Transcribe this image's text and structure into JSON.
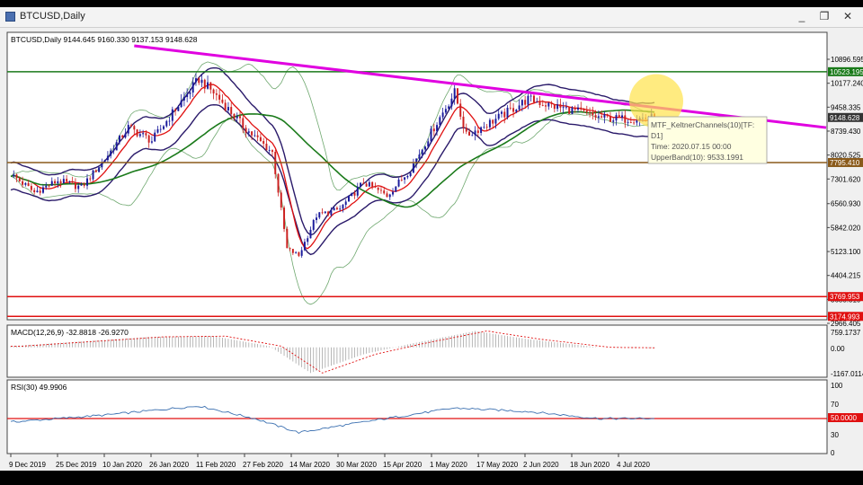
{
  "window": {
    "title": "BTCUSD,Daily",
    "minimize": "_",
    "restore": "❐",
    "close": "✕"
  },
  "colors": {
    "bull": "#1a1a9c",
    "bear": "#cc1f1f",
    "trendline": "#e000e0",
    "keltner": "#2a1a6a",
    "ma_red": "#e01010",
    "ma_green": "#1a7a1a",
    "bollinger": "#6fa86f",
    "level_green": "#1a7a1a",
    "level_brown": "#8a5a1a",
    "level_red": "#e01010",
    "macd": "#999999",
    "rsi": "#3a6fb0"
  },
  "main_chart": {
    "header": "BTCUSD,Daily  9144.645 9160.330 9137.153 9148.628",
    "price_axis": [
      "10896.595",
      "10177.240",
      "9458.335",
      "8739.430",
      "8020.525",
      "7301.620",
      "6560.930",
      "5842.020",
      "5123.100",
      "4404.215",
      "3685.310",
      "2966.405"
    ],
    "level_labels": [
      {
        "label": "10523.195",
        "value": 10523.195,
        "color": "#1a7a1a"
      },
      {
        "label": "9148.628",
        "value": 9148.628,
        "color": "#333333"
      },
      {
        "label": "7795.410",
        "value": 7795.41,
        "color": "#8a5a1a"
      },
      {
        "label": "3769.953",
        "value": 3769.953,
        "color": "#e01010"
      },
      {
        "label": "3174.993",
        "value": 3174.993,
        "color": "#e01010"
      }
    ],
    "tooltip": {
      "line1": "MTF_KeltnerChannels(10)[TF:",
      "line2": "D1]",
      "line3": "Time: 2020.07.15 00:00",
      "line4": "UpperBand(10): 9533.1991"
    }
  },
  "macd_panel": {
    "header": "MACD(12,26,9) -32.8818 -26.9270",
    "axis": [
      "759.1737",
      "0.00",
      "-1167.0114"
    ]
  },
  "rsi_panel": {
    "header": "RSI(30) 49.9906",
    "axis": [
      "100",
      "70",
      "50.0000",
      "30",
      "0"
    ]
  },
  "x_axis": [
    "9 Dec 2019",
    "25 Dec 2019",
    "10 Jan 2020",
    "26 Jan 2020",
    "11 Feb 2020",
    "27 Feb 2020",
    "14 Mar 2020",
    "30 Mar 2020",
    "15 Apr 2020",
    "1 May 2020",
    "17 May 2020",
    "2 Jun 2020",
    "18 Jun 2020",
    "4 Jul 2020"
  ],
  "chart_data": {
    "type": "candlestick",
    "title": "BTCUSD,Daily",
    "period": "Daily",
    "x_start": "2019-12-09",
    "x_end": "2020-07-15",
    "ylim": [
      2966.405,
      11300
    ],
    "close_anchors": [
      [
        "2019-12-09",
        7450
      ],
      [
        "2019-12-17",
        6900
      ],
      [
        "2019-12-25",
        7250
      ],
      [
        "2020-01-02",
        7050
      ],
      [
        "2020-01-10",
        7900
      ],
      [
        "2020-01-18",
        8850
      ],
      [
        "2020-01-26",
        8450
      ],
      [
        "2020-02-03",
        9400
      ],
      [
        "2020-02-11",
        10300
      ],
      [
        "2020-02-16",
        9900
      ],
      [
        "2020-02-27",
        8800
      ],
      [
        "2020-03-07",
        8100
      ],
      [
        "2020-03-12",
        5200
      ],
      [
        "2020-03-16",
        5000
      ],
      [
        "2020-03-22",
        6200
      ],
      [
        "2020-03-30",
        6400
      ],
      [
        "2020-04-07",
        7200
      ],
      [
        "2020-04-15",
        6800
      ],
      [
        "2020-04-23",
        7600
      ],
      [
        "2020-05-01",
        8850
      ],
      [
        "2020-05-08",
        9900
      ],
      [
        "2020-05-12",
        8600
      ],
      [
        "2020-05-24",
        9200
      ],
      [
        "2020-06-02",
        9700
      ],
      [
        "2020-06-10",
        9500
      ],
      [
        "2020-06-18",
        9350
      ],
      [
        "2020-06-26",
        9150
      ],
      [
        "2020-07-04",
        9100
      ],
      [
        "2020-07-15",
        9148.628
      ]
    ],
    "levels": [
      10523.195,
      7795.41,
      3769.953,
      3174.993
    ],
    "trendline": [
      [
        "2020-01-20",
        11300
      ],
      [
        "2020-07-25",
        9350
      ]
    ],
    "tooltip_marker": {
      "time": "2020-07-15",
      "value": 9533.1991
    },
    "macd": {
      "anchors": [
        [
          "2019-12-09",
          50
        ],
        [
          "2020-01-26",
          450
        ],
        [
          "2020-02-16",
          480
        ],
        [
          "2020-03-06",
          50
        ],
        [
          "2020-03-20",
          -1100
        ],
        [
          "2020-04-07",
          -300
        ],
        [
          "2020-04-23",
          150
        ],
        [
          "2020-05-15",
          700
        ],
        [
          "2020-06-02",
          350
        ],
        [
          "2020-06-26",
          0
        ],
        [
          "2020-07-15",
          -26.927
        ]
      ],
      "ylim": [
        -1167.0114,
        759.1737
      ]
    },
    "rsi": {
      "anchors": [
        [
          "2019-12-09",
          45
        ],
        [
          "2020-01-10",
          55
        ],
        [
          "2020-02-11",
          68
        ],
        [
          "2020-03-01",
          50
        ],
        [
          "2020-03-16",
          30
        ],
        [
          "2020-04-07",
          45
        ],
        [
          "2020-05-08",
          65
        ],
        [
          "2020-06-02",
          60
        ],
        [
          "2020-06-26",
          50
        ],
        [
          "2020-07-15",
          49.9906
        ]
      ],
      "ylim": [
        0,
        100
      ],
      "level": 50
    }
  }
}
